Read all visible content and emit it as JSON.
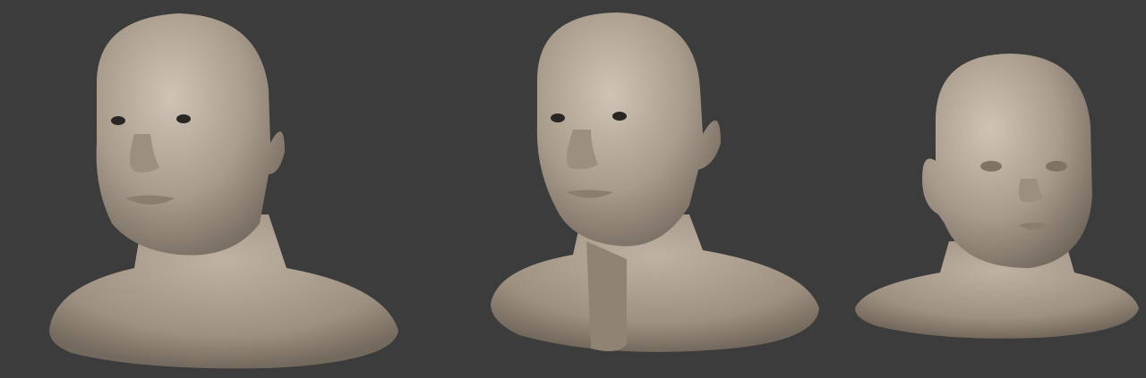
{
  "colors": {
    "background": "#3c3c3c",
    "clay_light": "#c8bcae",
    "clay_mid": "#a89b8c",
    "clay_dark": "#6e6459",
    "eye": "#2a2623"
  },
  "subjects": [
    {
      "id": "heavyset-man-bust"
    },
    {
      "id": "elderly-man-bust"
    },
    {
      "id": "child-bust"
    }
  ]
}
